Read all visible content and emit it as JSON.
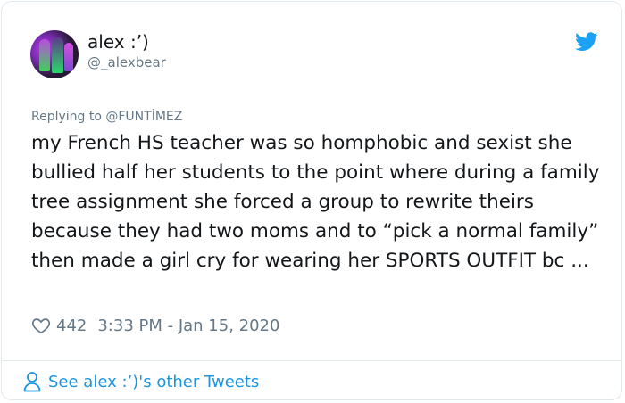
{
  "author": {
    "display_name": "alex :’)",
    "handle": "@_alexbear"
  },
  "icons": {
    "brand": "twitter-bird-icon",
    "like": "heart-icon",
    "profile": "person-icon"
  },
  "colors": {
    "brand_blue": "#1da1f2",
    "link_blue": "#1b95e0",
    "secondary_text": "#657786",
    "primary_text": "#14171a"
  },
  "tweet": {
    "replying_to": "Replying to @FUNTİMEZ",
    "text": "my French HS teacher was so homphobic and sexist she bullied half her students to the point where during a family tree assignment she forced a group to rewrite theirs because they had two moms and to “pick a normal family” then made a girl cry for wearing her SPORTS OUTFIT bc ...",
    "likes": "442",
    "timestamp": "3:33 PM - Jan 15, 2020"
  },
  "footer": {
    "see_more": "See alex :’)'s other Tweets"
  }
}
